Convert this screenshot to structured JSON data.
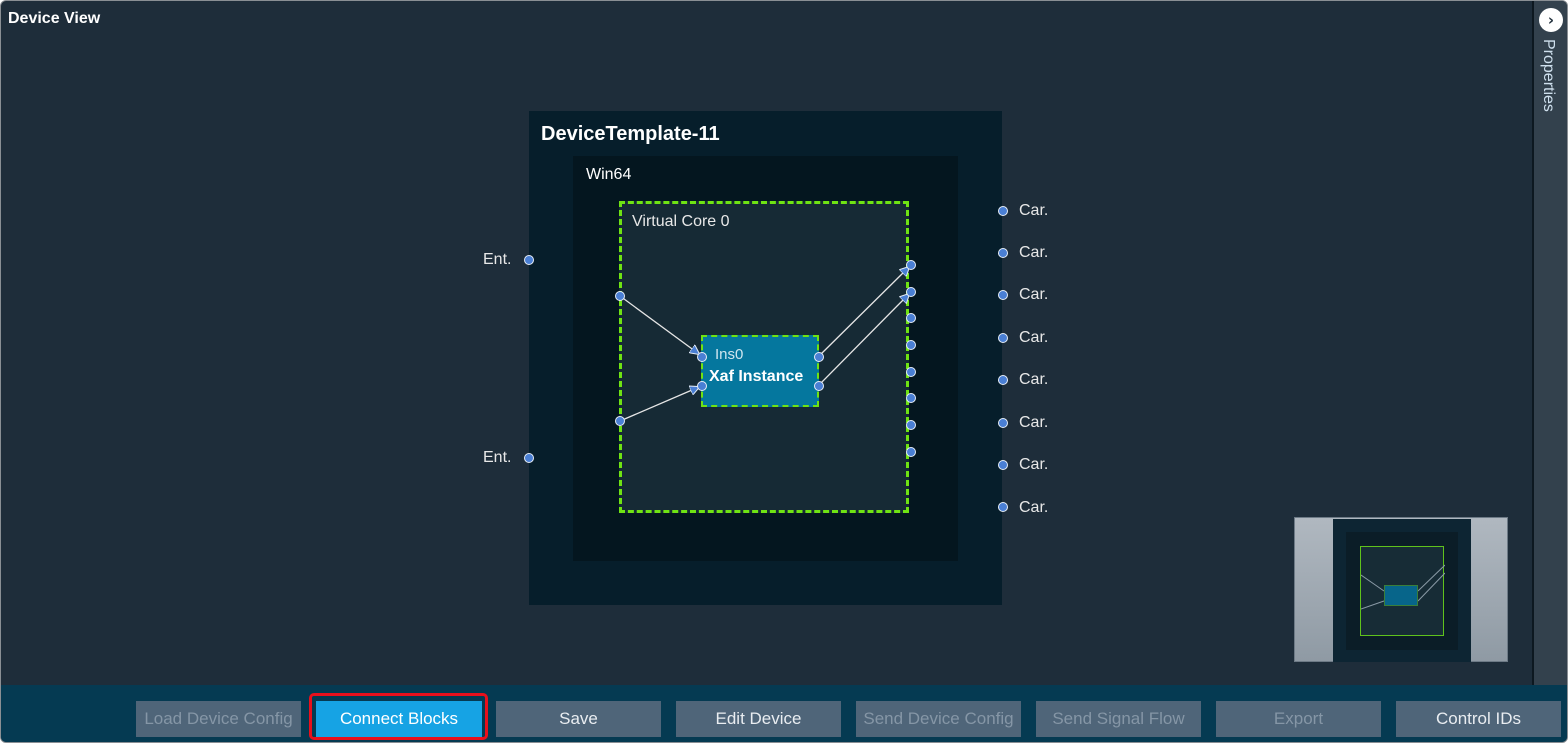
{
  "window": {
    "title": "Device View"
  },
  "properties_panel": {
    "label": "Properties",
    "toggle_icon": "chevron-right-icon"
  },
  "diagram": {
    "device": {
      "title": "DeviceTemplate-11"
    },
    "platform": {
      "title": "Win64"
    },
    "core": {
      "title": "Virtual Core 0"
    },
    "instance": {
      "id": "Ins0",
      "name": "Xaf Instance"
    },
    "input_ports": [
      {
        "label": "Ent."
      },
      {
        "label": "Ent."
      }
    ],
    "output_ports": [
      {
        "label": "Car."
      },
      {
        "label": "Car."
      },
      {
        "label": "Car."
      },
      {
        "label": "Car."
      },
      {
        "label": "Car."
      },
      {
        "label": "Car."
      },
      {
        "label": "Car."
      },
      {
        "label": "Car."
      }
    ],
    "colors": {
      "port": "#4a7fd4",
      "core_border": "#6fe313",
      "instance": "#05779e"
    }
  },
  "toolbar": {
    "buttons": [
      {
        "label": "Load Device Config",
        "enabled": false
      },
      {
        "label": "Connect Blocks",
        "enabled": true,
        "active": true
      },
      {
        "label": "Save",
        "enabled": true
      },
      {
        "label": "Edit Device",
        "enabled": true
      },
      {
        "label": "Send Device Config",
        "enabled": false
      },
      {
        "label": "Send Signal Flow",
        "enabled": false
      },
      {
        "label": "Export",
        "enabled": false
      },
      {
        "label": "Control IDs",
        "enabled": true
      }
    ]
  }
}
